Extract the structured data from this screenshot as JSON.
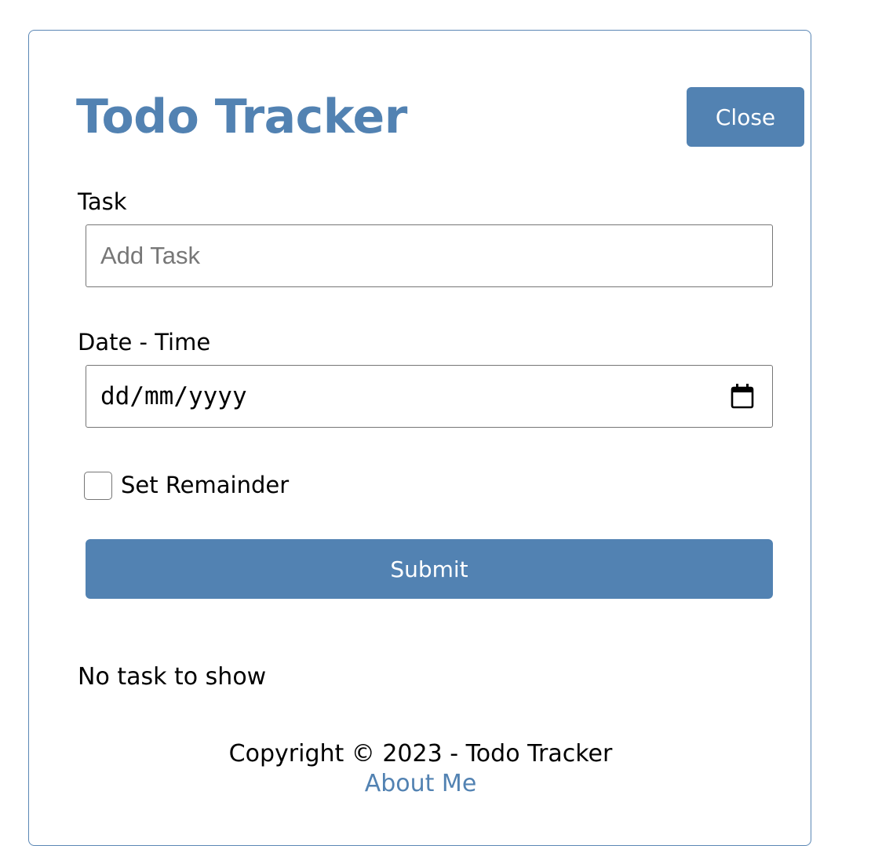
{
  "header": {
    "title": "Todo Tracker",
    "close_label": "Close"
  },
  "form": {
    "task_label": "Task",
    "task_placeholder": "Add Task",
    "task_value": "",
    "datetime_label": "Date - Time",
    "datetime_placeholder": "dd/mm/yyyy",
    "reminder_label": "Set Remainder",
    "reminder_checked": false,
    "submit_label": "Submit"
  },
  "tasks": {
    "empty_message": "No task to show"
  },
  "footer": {
    "copyright": "Copyright © 2023 - Todo Tracker",
    "about_link": "About Me"
  },
  "icons": {
    "datetime": "calendar-icon"
  },
  "colors": {
    "accent": "#5282b2",
    "border": "#5b87b5",
    "input_border": "#767676"
  }
}
